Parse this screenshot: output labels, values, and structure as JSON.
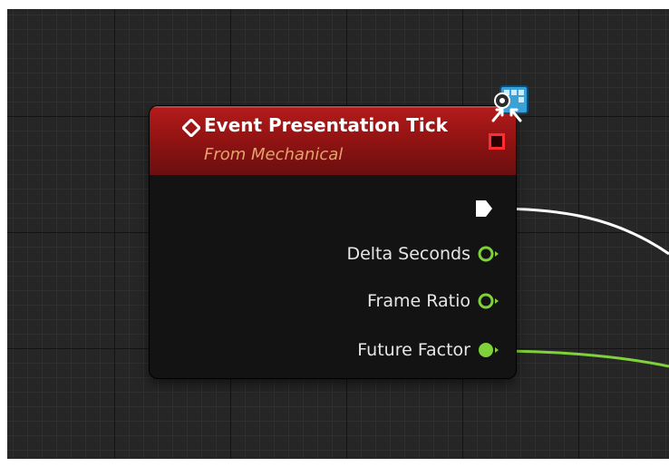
{
  "graph": {
    "node": {
      "title": "Event Presentation Tick",
      "subtitle": "From Mechanical",
      "header_color": "#a11616",
      "icons": [
        "event-diamond-icon",
        "stop-icon",
        "blueprint-badge-icon"
      ],
      "output_pins": [
        {
          "label": "Delta Seconds",
          "type": "float",
          "connected": false
        },
        {
          "label": "Frame Ratio",
          "type": "float",
          "connected": false
        },
        {
          "label": "Future Factor",
          "type": "float",
          "connected": true
        }
      ],
      "exec_output": {
        "connected": true
      }
    },
    "wires": [
      {
        "from": "exec-out",
        "color": "#ffffff"
      },
      {
        "from": "future-factor",
        "color": "#7fd23a"
      }
    ]
  }
}
